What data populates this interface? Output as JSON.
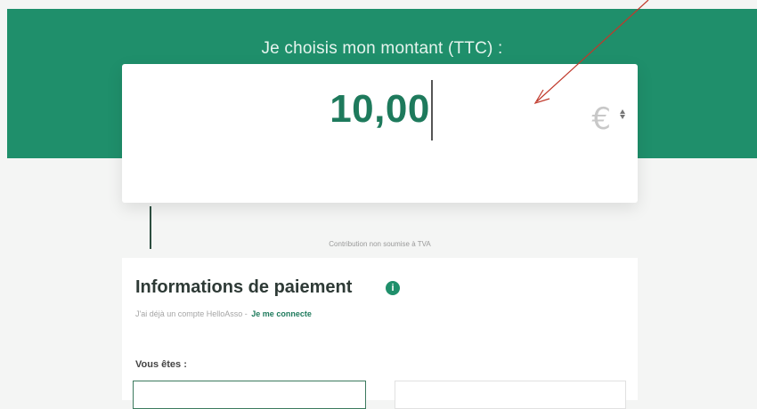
{
  "header": {
    "title": "Je choisis mon montant (TTC) :"
  },
  "amount": {
    "value": "10,00",
    "currency": "€",
    "tax_note": "Contribution non soumise à TVA"
  },
  "payment": {
    "title": "Informations de paiement",
    "info_icon": "info-icon",
    "account_prompt": "J'ai déjà un compte HelloAsso -",
    "login_link": "Je me connecte",
    "you_are_label": "Vous êtes :"
  },
  "annotation": {
    "arrow_color": "#c0392b"
  }
}
